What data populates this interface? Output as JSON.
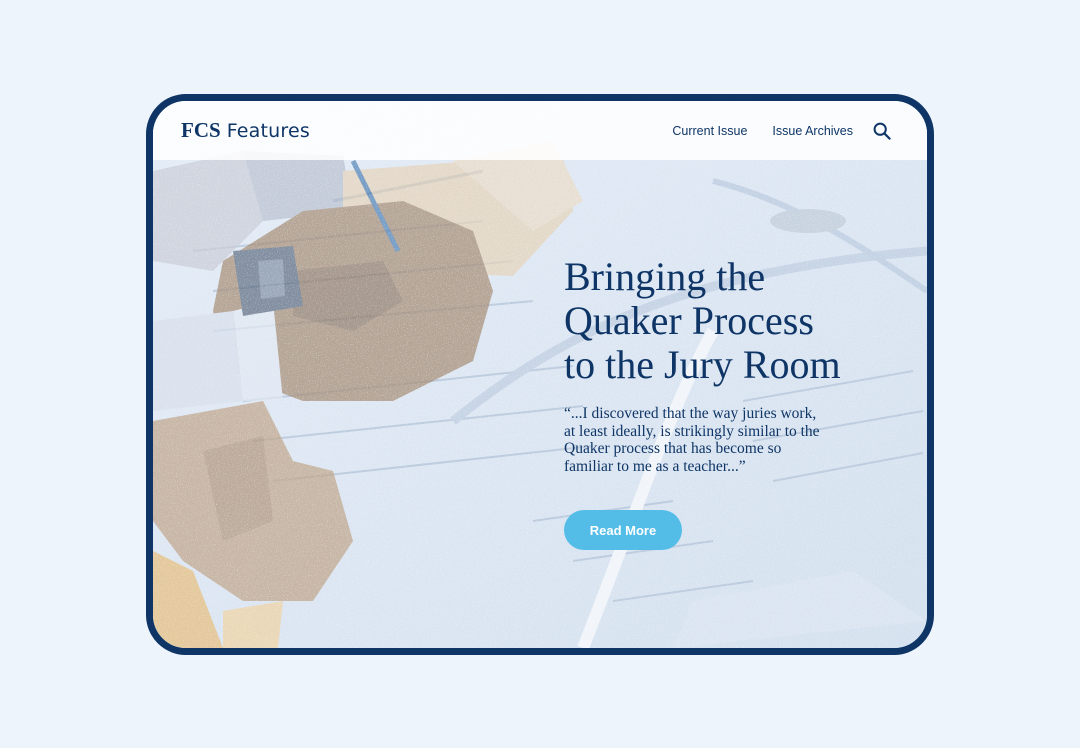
{
  "brand": {
    "abbr": "FCS",
    "word": "Features"
  },
  "nav": {
    "items": [
      {
        "label": "Current Issue"
      },
      {
        "label": "Issue Archives"
      }
    ],
    "search_icon": "search-icon"
  },
  "hero": {
    "title_lines": [
      "Bringing the",
      "Quaker Process",
      "to the Jury Room"
    ],
    "quote_lines": [
      "“...I discovered that the way juries work,",
      "at least ideally, is strikingly similar to the",
      "Quaker process that has become so",
      "familiar to me as a teacher...”"
    ],
    "cta_label": "Read More"
  },
  "colors": {
    "brand_navy": "#0e3566",
    "accent_blue": "#53bde8",
    "page_background": "#eef4fc"
  }
}
